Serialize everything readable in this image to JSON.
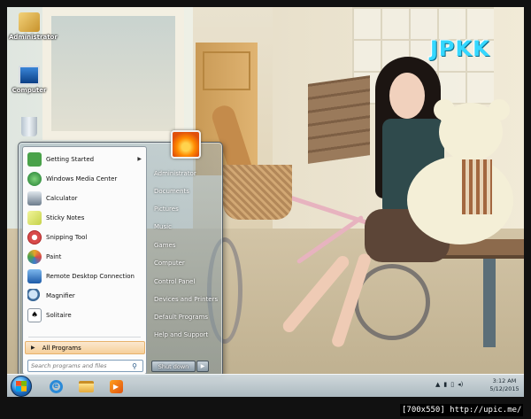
{
  "watermark": "JPKK",
  "desktop": {
    "icons": [
      {
        "label": "Administrator",
        "icon": "user-folder-icon"
      },
      {
        "label": "Computer",
        "icon": "computer-icon"
      },
      {
        "label": "",
        "icon": "recycle-bin-icon"
      }
    ]
  },
  "start_menu": {
    "programs": [
      {
        "label": "Getting Started",
        "icon": "getting-started-icon",
        "color": "#4aa24a",
        "submenu": true
      },
      {
        "label": "Windows Media Center",
        "icon": "media-center-icon",
        "color": "#2f8f3e"
      },
      {
        "label": "Calculator",
        "icon": "calculator-icon",
        "color": "#6c7c8c"
      },
      {
        "label": "Sticky Notes",
        "icon": "sticky-notes-icon",
        "color": "#d9e36a"
      },
      {
        "label": "Snipping Tool",
        "icon": "snipping-tool-icon",
        "color": "#d84a4a"
      },
      {
        "label": "Paint",
        "icon": "paint-icon",
        "color": "#e6a52a"
      },
      {
        "label": "Remote Desktop Connection",
        "icon": "remote-desktop-icon",
        "color": "#3a7cc9"
      },
      {
        "label": "Magnifier",
        "icon": "magnifier-icon",
        "color": "#5b87b8"
      },
      {
        "label": "Solitaire",
        "icon": "solitaire-icon",
        "color": "#b9c6d2"
      }
    ],
    "all_programs": "All Programs",
    "search_placeholder": "Search programs and files",
    "right_items": [
      "Administrator",
      "Documents",
      "Pictures",
      "Music",
      "Games",
      "Computer",
      "Control Panel",
      "Devices and Printers",
      "Default Programs",
      "Help and Support"
    ],
    "shutdown": "Shut down"
  },
  "taskbar": {
    "tray": [
      "▲",
      "▮",
      "▯",
      "◂)"
    ],
    "time": "3:12 AM",
    "date": "5/12/2015"
  },
  "credit": "[700x550] http://upic.me/"
}
